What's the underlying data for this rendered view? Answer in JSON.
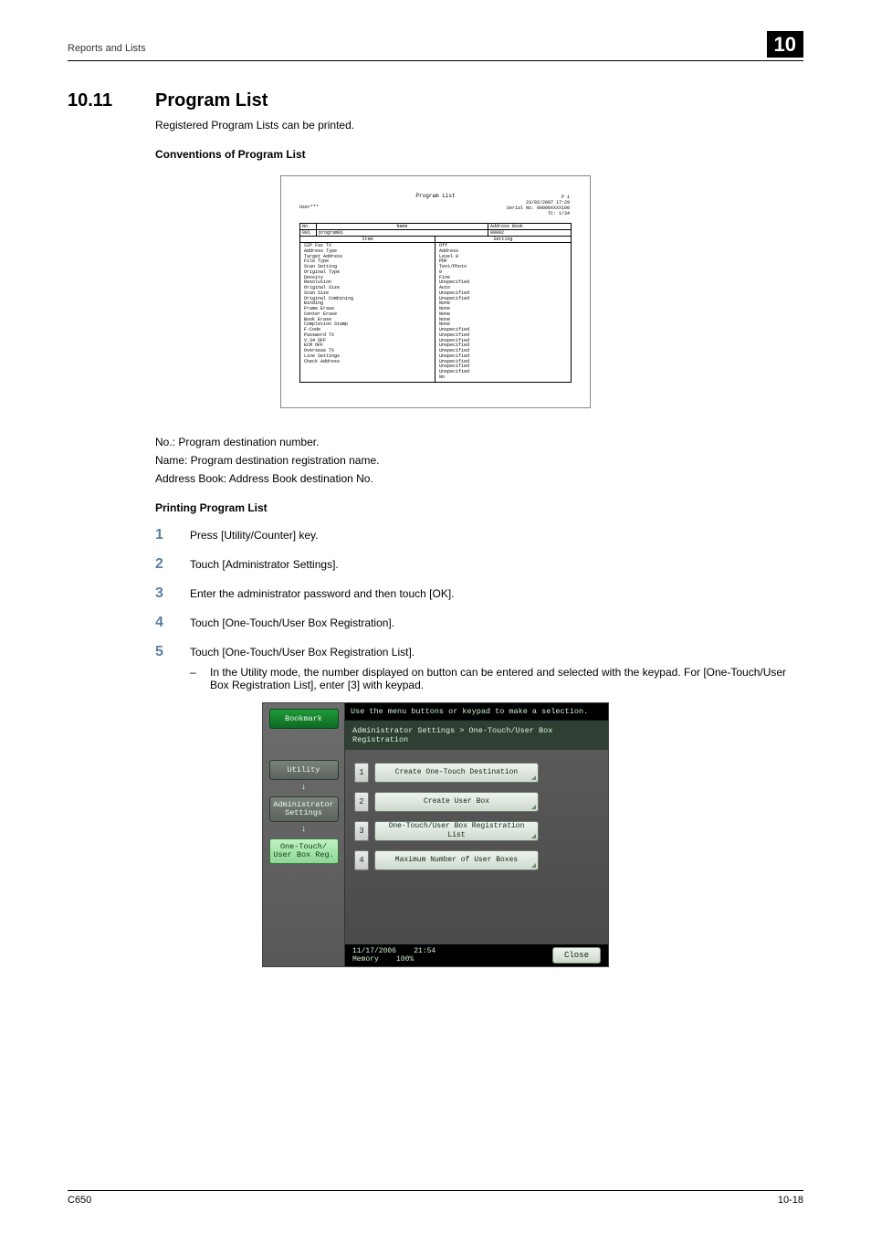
{
  "header": {
    "breadcrumb": "Reports and Lists",
    "chapter": "10"
  },
  "section": {
    "number": "10.11",
    "title": "Program List"
  },
  "intro": "Registered Program Lists can be printed.",
  "h_conventions": "Conventions of Program List",
  "sample": {
    "title": "Program List",
    "meta_p": "P   1",
    "meta_date": "23/02/2007 17:29",
    "meta_serial": "Serial No.   00000XXXX100",
    "meta_tc": "TC:        1/34",
    "user_label": "User***",
    "no_label": "No.",
    "name_label": "Name",
    "addr_label": "Address Book",
    "row_no": "001",
    "row_name": "program01",
    "row_addr": "00002",
    "item_head": "Item",
    "setting_head": "Setting",
    "items": [
      "SIP Fax TX",
      "Address Type",
      "Target Address",
      "File Type",
      "Scan Setting",
      "Original Type",
      "Density",
      "Resolution",
      "Original Size",
      "Scan Size",
      "Original Combining",
      "Binding",
      "Frame Erase",
      "Center Erase",
      "Book Erase",
      "Completion Stamp",
      "F-Code",
      "Password TX",
      "V.34 OFF",
      "ECM OFF",
      "Overseas TX",
      "Line Settings",
      "Check Address"
    ],
    "settings": [
      "Off",
      "Address",
      "Level 0",
      "PDF",
      "",
      "Text/Photo",
      "0",
      "Fine",
      "",
      "Unspecified",
      "Auto",
      "Unspecified",
      "Unspecified",
      "None",
      "None",
      "None",
      "None",
      "None",
      "Unspecified",
      "Unspecified",
      "Unspecified",
      "Unspecified",
      "Unspecified",
      "Unspecified",
      "Unspecified",
      "Unspecified",
      "Unspecified",
      "No"
    ]
  },
  "definitions": {
    "no": "No.: Program destination number.",
    "name": "Name: Program destination registration name.",
    "addr": "Address Book: Address Book destination No."
  },
  "h_printing": "Printing Program List",
  "steps": [
    "Press [Utility/Counter] key.",
    "Touch [Administrator Settings].",
    "Enter the administrator password and then touch [OK].",
    "Touch [One-Touch/User Box Registration].",
    "Touch [One-Touch/User Box Registration List]."
  ],
  "step5_note": "In the Utility mode, the number displayed on button can be entered and selected with the keypad. For [One-Touch/User Box Registration List], enter [3] with keypad.",
  "touchscreen": {
    "instruction": "Use the menu buttons or keypad to make a selection.",
    "breadcrumb": "Administrator Settings > One-Touch/User Box Registration",
    "nav": {
      "bookmark": "Bookmark",
      "utility": "Utility",
      "admin": "Administrator Settings",
      "onetouch": "One-Touch/ User Box Reg."
    },
    "menu": [
      {
        "n": "1",
        "label": "Create One-Touch Destination"
      },
      {
        "n": "2",
        "label": "Create User Box"
      },
      {
        "n": "3",
        "label": "One-Touch/User Box Registration List"
      },
      {
        "n": "4",
        "label": "Maximum Number of User Boxes"
      }
    ],
    "date": "11/17/2006",
    "time": "21:54",
    "memory_label": "Memory",
    "memory_val": "100%",
    "close": "Close"
  },
  "footer": {
    "left": "C650",
    "right": "10-18"
  }
}
